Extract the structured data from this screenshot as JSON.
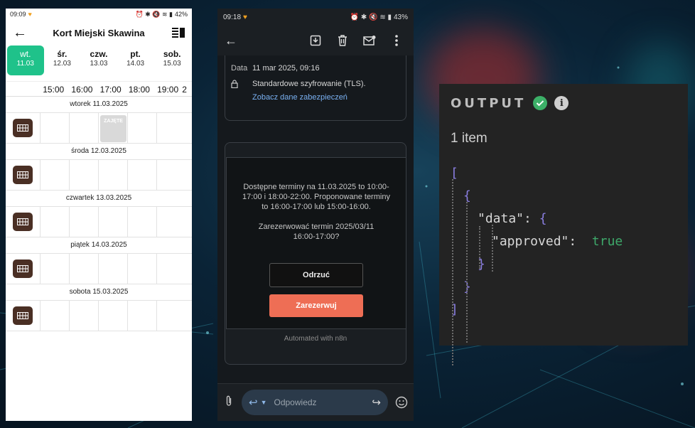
{
  "booking_app": {
    "status_time": "09:09",
    "status_battery": "42%",
    "title": "Kort Miejski Skawina",
    "days": [
      {
        "name": "wt.",
        "date": "11.03",
        "active": true
      },
      {
        "name": "śr.",
        "date": "12.03"
      },
      {
        "name": "czw.",
        "date": "13.03"
      },
      {
        "name": "pt.",
        "date": "14.03"
      },
      {
        "name": "sob.",
        "date": "15.03"
      }
    ],
    "hours": [
      "15:00",
      "16:00",
      "17:00",
      "18:00",
      "19:00",
      "2"
    ],
    "rows": [
      {
        "label": "wtorek 11.03.2025",
        "taken_label": "ZAJĘTE"
      },
      {
        "label": "środa 12.03.2025"
      },
      {
        "label": "czwartek 13.03.2025"
      },
      {
        "label": "piątek 14.03.2025"
      },
      {
        "label": "sobota 15.03.2025"
      }
    ]
  },
  "email_app": {
    "status_time": "09:18",
    "status_battery": "43%",
    "date_label": "Data",
    "date_value": "11 mar 2025, 09:16",
    "encryption": "Standardowe szyfrowanie (TLS).",
    "security_link": "Zobacz dane zabezpieczeń",
    "message": "Dostępne terminy na 11.03.2025 to 10:00-17:00 i 18:00-22:00. Proponowane terminy to 16:00-17:00 lub 15:00-16:00.",
    "question": "Zarezerwować termin 2025/03/11 16:00-17:00?",
    "decline_label": "Odrzuć",
    "book_label": "Zarezerwuj",
    "automated_note": "Automated with n8n",
    "reply_placeholder": "Odpowiedz",
    "accent_color": "#ee6e55"
  },
  "output_panel": {
    "title": "OUTPUT",
    "count": "1 item",
    "json_lines": {
      "open_arr": "[",
      "open_obj": "{",
      "data_key": "\"data\"",
      "colon1": ": ",
      "open_data": "{",
      "approved_key": "\"approved\"",
      "colon2": ":  ",
      "approved_val": "true",
      "close_data": "}",
      "close_obj": "}",
      "close_arr": "]"
    }
  }
}
